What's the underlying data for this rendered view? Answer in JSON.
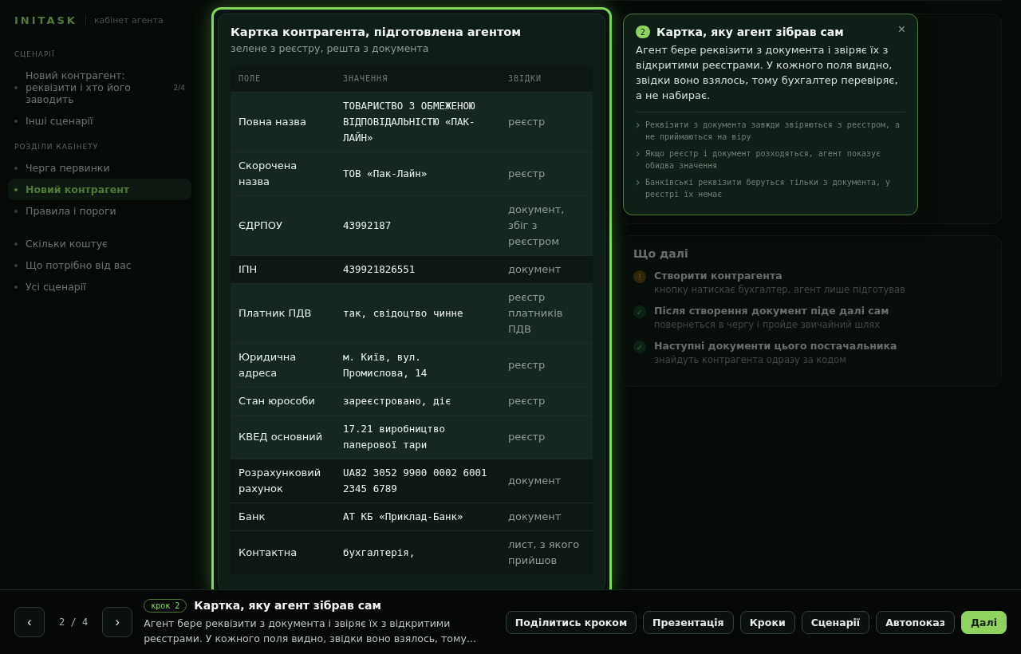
{
  "brand": {
    "logo": "INITASK",
    "subtitle": "кабінет агента"
  },
  "sidebar": {
    "sections": [
      {
        "title": "СЦЕНАРІЇ",
        "items": [
          {
            "label": "Новий контрагент: реквізити і хто його заводить",
            "count": "2/4",
            "selected": false
          },
          {
            "label": "Інші сценарії",
            "selected": false
          }
        ]
      },
      {
        "title": "РОЗДІЛИ КАБІНЕТУ",
        "items": [
          {
            "label": "Черга первинки",
            "selected": false
          },
          {
            "label": "Новий контрагент",
            "selected": true
          },
          {
            "label": "Правила і пороги",
            "selected": false
          }
        ]
      },
      {
        "items": [
          {
            "label": "Скільки коштує",
            "selected": false
          },
          {
            "label": "Що потрібно від вас",
            "selected": false
          },
          {
            "label": "Усі сценарії",
            "selected": false
          }
        ]
      }
    ]
  },
  "card": {
    "title": "Картка контрагента, підготовлена агентом",
    "subtitle": "зелене з реєстру, решта з документа",
    "columns": [
      "ПОЛЕ",
      "ЗНАЧЕННЯ",
      "ЗВІДКИ"
    ],
    "rows": [
      {
        "field": "Повна назва",
        "value": "ТОВАРИСТВО З ОБМЕЖЕНОЮ ВІДПОВІДАЛЬНІСТЮ «ПАК-ЛАЙН»",
        "source": "реєстр",
        "registry": true
      },
      {
        "field": "Скорочена назва",
        "value": "ТОВ «Пак-Лайн»",
        "source": "реєстр",
        "registry": true
      },
      {
        "field": "ЄДРПОУ",
        "value": "43992187",
        "source": "документ, збіг з реєстром",
        "registry": true
      },
      {
        "field": "ІПН",
        "value": "439921826551",
        "source": "документ",
        "registry": false
      },
      {
        "field": "Платник ПДВ",
        "value": "так, свідоцтво чинне",
        "source": "реєстр платників ПДВ",
        "registry": true
      },
      {
        "field": "Юридична адреса",
        "value": "м. Київ, вул. Промислова, 14",
        "source": "реєстр",
        "registry": true
      },
      {
        "field": "Стан юрособи",
        "value": "зареєстровано, діє",
        "source": "реєстр",
        "registry": true
      },
      {
        "field": "КВЕД основний",
        "value": "17.21 виробництво паперової тари",
        "source": "реєстр",
        "registry": true
      },
      {
        "field": "Розрахунковий рахунок",
        "value": "UA82 3052 9900 0002 6001 2345 6789",
        "source": "документ",
        "registry": false
      },
      {
        "field": "Банк",
        "value": "АТ КБ «Приклад-Банк»",
        "source": "документ",
        "registry": false
      },
      {
        "field": "Контактна",
        "value": "бухгалтерія,",
        "source": "лист, з якого прийшов",
        "registry": false
      }
    ]
  },
  "next": {
    "title": "Що далі",
    "items": [
      {
        "kind": "warn",
        "icon": "!",
        "title": "Створити контрагента",
        "text": "кнопку натискає бухгалтер, агент лише підготував"
      },
      {
        "kind": "done",
        "icon": "✓",
        "title": "Після створення документ піде далі сам",
        "text": "повернеться в чергу і пройде звичайний шлях"
      },
      {
        "kind": "done",
        "icon": "✓",
        "title": "Наступні документи цього постачальника",
        "text": "знайдуть контрагента одразу за кодом"
      }
    ]
  },
  "tooltip": {
    "step": "2",
    "title": "Картка, яку агент зібрав сам",
    "close": "×",
    "text": "Агент бере реквізити з документа і звіряє їх з відкритими реєстрами. У кожного поля видно, звідки воно взялось, тому бухгалтер перевіряє, а не набирає.",
    "points": [
      "Реквізити з документа завжди звіряються з реєстром, а не приймаються на віру",
      "Якщо реєстр і документ розходяться, агент показує обидва значення",
      "Банківські реквізити беруться тільки з документа, у реєстрі їх немає"
    ]
  },
  "tour": {
    "prev": "‹",
    "counter": "2 / 4",
    "next": "›",
    "badge": "крок 2",
    "title": "Картка, яку агент зібрав сам",
    "text": "Агент бере реквізити з документа і звіряє їх з відкритими реєстрами. У кожного поля видно, звідки воно взялось, тому…",
    "buttons": [
      {
        "label": "Поділитись кроком",
        "primary": false
      },
      {
        "label": "Презентація",
        "primary": false
      },
      {
        "label": "Кроки",
        "primary": false
      },
      {
        "label": "Сценарії",
        "primary": false
      },
      {
        "label": "Автопоказ",
        "primary": false
      },
      {
        "label": "Далі",
        "primary": true
      }
    ]
  }
}
